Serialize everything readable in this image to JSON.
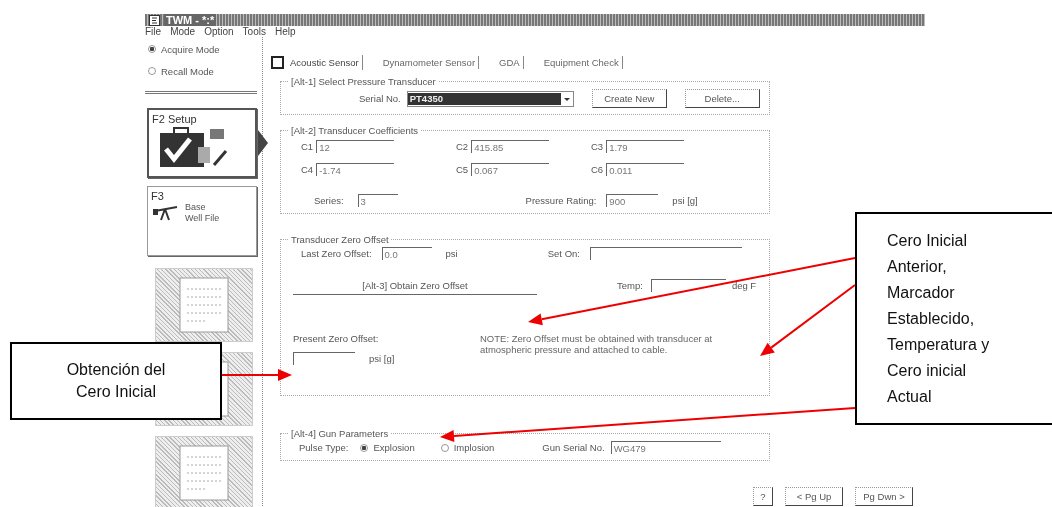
{
  "window": {
    "title": "TWM - *:*"
  },
  "menu": [
    "File",
    "Mode",
    "Option",
    "Tools",
    "Help"
  ],
  "modes": [
    {
      "label": "Acquire Mode",
      "selected": true
    },
    {
      "label": "Recall Mode",
      "selected": false
    }
  ],
  "nav": [
    {
      "kind": "setup",
      "key": "F2",
      "label": "Setup",
      "selected": true
    },
    {
      "kind": "wellfile",
      "key": "F3",
      "label": "Base Well File",
      "selected": false
    },
    {
      "kind": "thumb"
    },
    {
      "kind": "thumb"
    },
    {
      "kind": "thumb"
    }
  ],
  "tabs": [
    {
      "label": "Acoustic Sensor",
      "selected": true
    },
    {
      "label": "Dynamometer Sensor",
      "selected": false
    },
    {
      "label": "GDA",
      "selected": false
    },
    {
      "label": "Equipment Check",
      "selected": false
    }
  ],
  "pressure_transducer": {
    "title": "[Alt-1]  Select Pressure Transducer",
    "serial_label": "Serial No.",
    "serial_value": "PT4350",
    "buttons": [
      "Create New",
      "Delete..."
    ]
  },
  "coefficients": {
    "title": "[Alt-2]  Transducer Coefficients",
    "fields": [
      {
        "label": "C1",
        "value": "12"
      },
      {
        "label": "C2",
        "value": "415.85"
      },
      {
        "label": "C3",
        "value": "1.79"
      },
      {
        "label": "C4",
        "value": "-1.74"
      },
      {
        "label": "C5",
        "value": "0.067"
      },
      {
        "label": "C6",
        "value": "0.011"
      }
    ],
    "series_label": "Series:",
    "series_value": "3",
    "rating_label": "Pressure Rating:",
    "rating_value": "900",
    "rating_unit": "psi [g]"
  },
  "zero_offset": {
    "title": "Transducer Zero Offset",
    "last_label": "Last Zero Offset:",
    "last_value": "0.0",
    "last_unit": "psi",
    "set_on_label": "Set On:",
    "obtain_button": "[Alt-3]  Obtain Zero Offset",
    "temp_label": "Temp:",
    "temp_unit": "deg F",
    "present_label": "Present Zero Offset:",
    "present_unit": "psi [g]",
    "note": "NOTE:  Zero Offset must be obtained with transducer at atmospheric pressure and attached to cable."
  },
  "gun": {
    "title": "[Alt-4]  Gun Parameters",
    "pulse_label": "Pulse Type:",
    "pulse_options": [
      {
        "label": "Explosion",
        "selected": true
      },
      {
        "label": "Implosion",
        "selected": false
      }
    ],
    "serial_label": "Gun Serial No.",
    "serial_value": "WG479"
  },
  "footer_buttons": [
    "?",
    "< Pg Up",
    "Pg Dwn >"
  ],
  "callouts": [
    "Obtención del Cero Inicial",
    "Cero Inicial Anterior, Marcador Establecido, Temperatura y Cero inicial Actual"
  ]
}
